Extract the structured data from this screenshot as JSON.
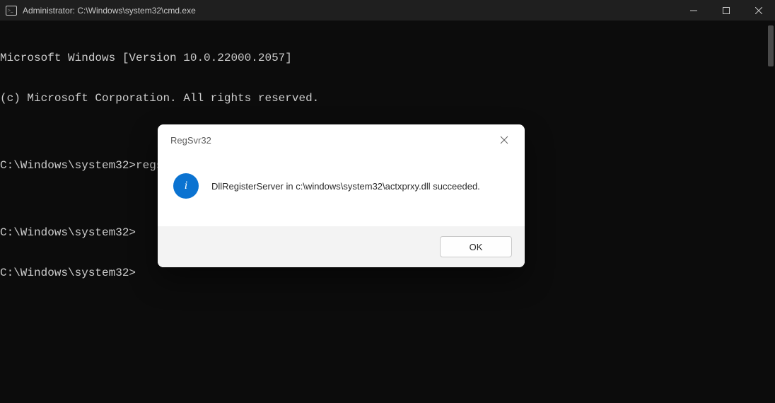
{
  "window": {
    "title": "Administrator: C:\\Windows\\system32\\cmd.exe"
  },
  "terminal": {
    "lines": [
      "Microsoft Windows [Version 10.0.22000.2057]",
      "(c) Microsoft Corporation. All rights reserved.",
      "",
      "C:\\Windows\\system32>regsvr32 c:\\windows\\system32\\actxprxy.dll",
      "",
      "C:\\Windows\\system32>",
      "C:\\Windows\\system32>"
    ]
  },
  "dialog": {
    "title": "RegSvr32",
    "message": "DllRegisterServer in c:\\windows\\system32\\actxprxy.dll succeeded.",
    "ok_label": "OK",
    "info_glyph": "i"
  }
}
